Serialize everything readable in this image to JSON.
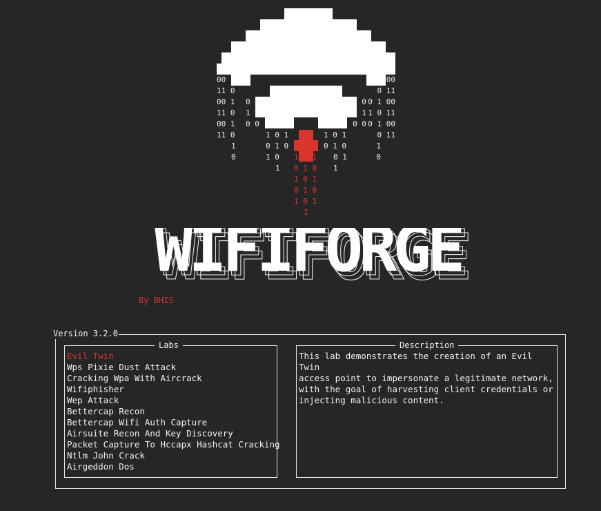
{
  "app": {
    "title": "WIFIFORGE",
    "byline": "By BHIS",
    "version": "Version 3.2.0"
  },
  "colors": {
    "background": "#262626",
    "foreground": "#f2f2f2",
    "accent": "#d9352c"
  },
  "logo": {
    "icon": "wifi-helmet-icon",
    "bits": {
      "left": [
        "00",
        "11 0",
        "00 1",
        "11 0",
        "00 1",
        "11 0",
        "1",
        "0"
      ],
      "right": [
        "00",
        "0 11",
        "0 1 00",
        "1 0 11",
        "0 1 00",
        "0 11",
        "1",
        "0"
      ],
      "inner_left": [
        "0",
        "1",
        "0 0"
      ],
      "inner_right": [
        "0",
        "1",
        "0 0"
      ],
      "near_left": [
        "1 0 1",
        "0 1 0",
        "1 0",
        "1"
      ],
      "near_right": [
        "1 0 1",
        "0 1 0",
        "0 1",
        "1"
      ],
      "red": [
        "1   1",
        "0 1 0",
        "1 0 1",
        "0 1 0",
        "1 0 1",
        "1"
      ]
    }
  },
  "labs": {
    "title": "Labs",
    "items": [
      {
        "label": "Evil Twin",
        "selected": true
      },
      {
        "label": "Wps Pixie Dust Attack",
        "selected": false
      },
      {
        "label": "Cracking Wpa With Aircrack",
        "selected": false
      },
      {
        "label": "Wifiphisher",
        "selected": false
      },
      {
        "label": "Wep Attack",
        "selected": false
      },
      {
        "label": "Bettercap Recon",
        "selected": false
      },
      {
        "label": "Bettercap Wifi Auth Capture",
        "selected": false
      },
      {
        "label": "Airsuite Recon And Key Discovery",
        "selected": false
      },
      {
        "label": "Packet Capture To Hccapx Hashcat Cracking",
        "selected": false
      },
      {
        "label": "Ntlm John Crack",
        "selected": false
      },
      {
        "label": "Airgeddon Dos",
        "selected": false
      }
    ]
  },
  "description": {
    "title": "Description",
    "text": "This lab demonstrates the creation of an Evil Twin\naccess point to impersonate a legitimate network,\nwith the goal of harvesting client credentials or\ninjecting malicious content."
  }
}
